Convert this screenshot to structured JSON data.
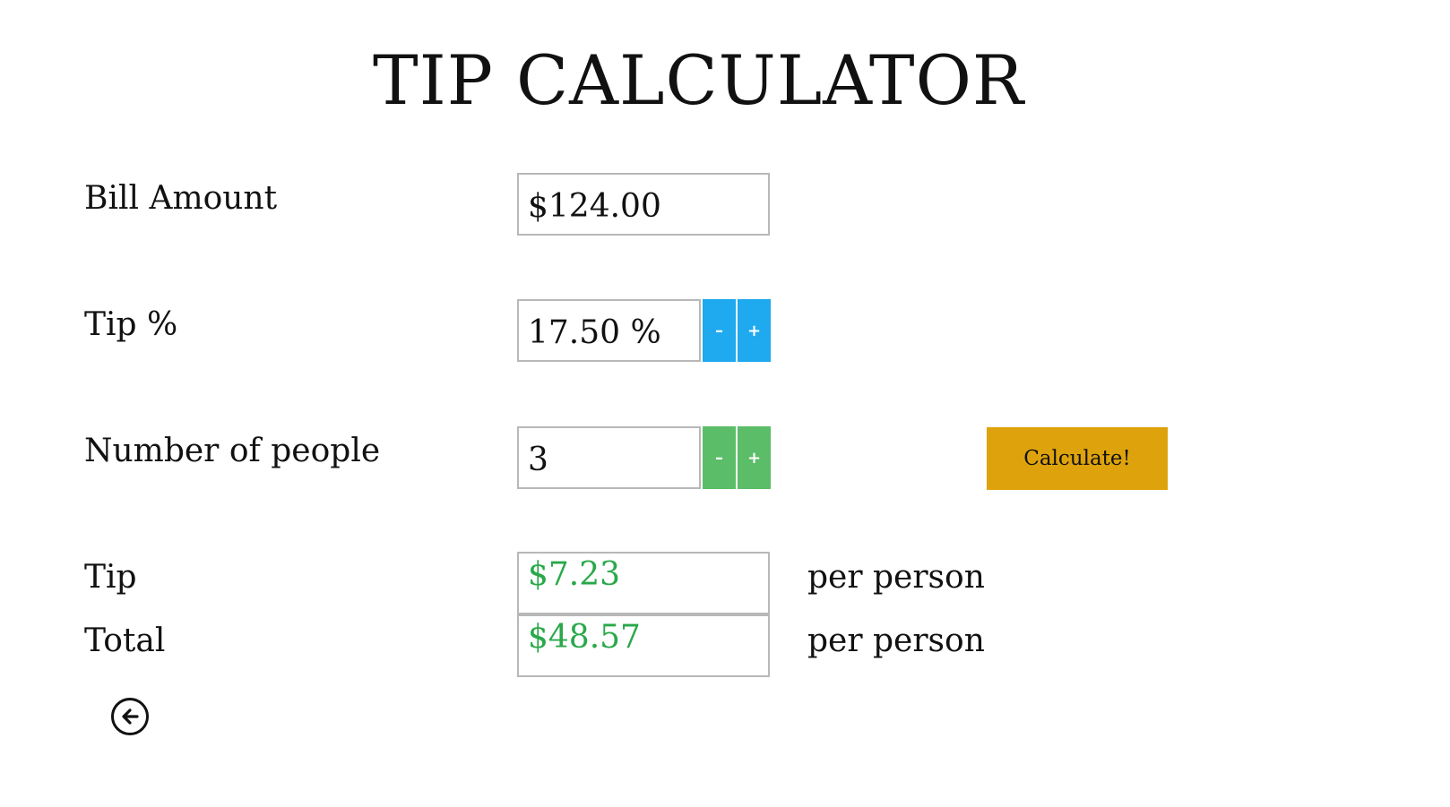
{
  "title": "TIP CALCULATOR",
  "bill": {
    "label": "Bill Amount",
    "value": "$124.00"
  },
  "tip_percent": {
    "label": "Tip %",
    "value": "17.50 %",
    "minus_label": "–",
    "plus_label": "+"
  },
  "people": {
    "label": "Number of people",
    "value": "3",
    "minus_label": "–",
    "plus_label": "+"
  },
  "calculate_label": "Calculate!",
  "results": {
    "tip": {
      "label": "Tip",
      "value": "$7.23",
      "suffix": "per person"
    },
    "total": {
      "label": "Total",
      "value": "$48.57",
      "suffix": "per person"
    }
  },
  "back_icon": "back-arrow-icon",
  "colors": {
    "tip_stepper": "#1fa9ef",
    "people_stepper": "#5bbd68",
    "calculate_button": "#dea30c",
    "result_text": "#2aa84a"
  }
}
